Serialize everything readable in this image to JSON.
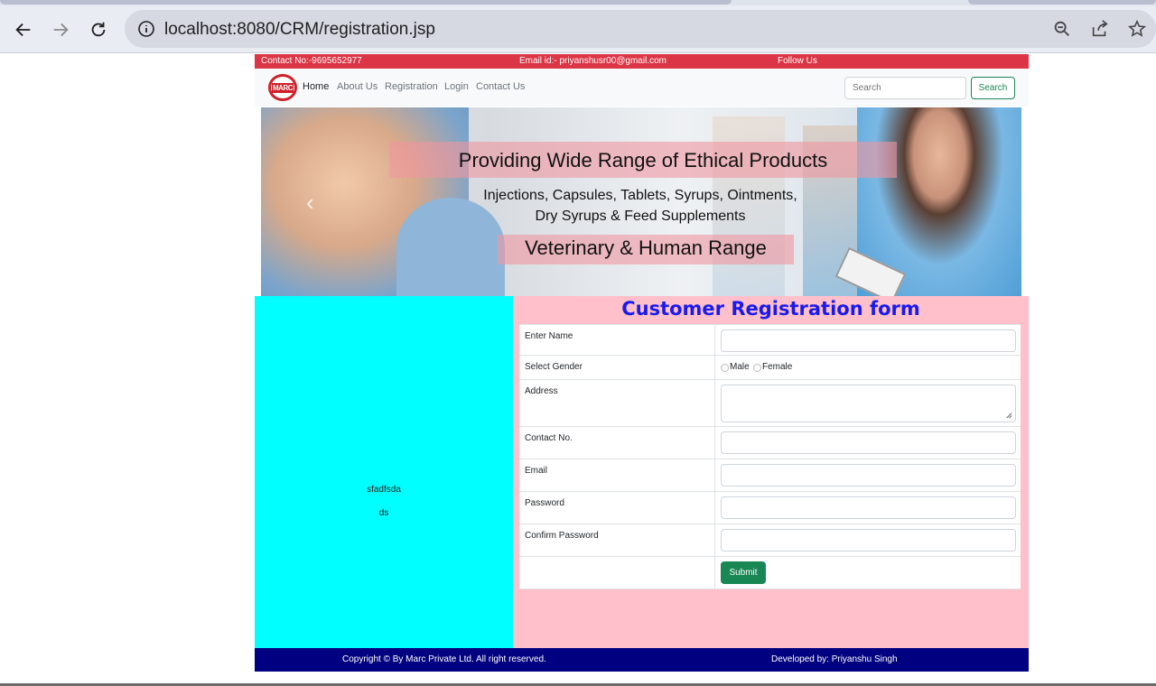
{
  "browser": {
    "url": "localhost:8080/CRM/registration.jsp"
  },
  "topbar": {
    "contact": "Contact No:-9695652977",
    "email": "Email id:- priyanshusr00@gmail.com",
    "follow": "Follow Us"
  },
  "navbar": {
    "logo_text": "MARC",
    "links": [
      "Home",
      "About Us",
      "Registration",
      "Login",
      "Contact Us"
    ],
    "search_placeholder": "Search",
    "search_button": "Search"
  },
  "banner": {
    "title": "Providing Wide Range of Ethical Products",
    "line1": "Injections, Capsules, Tablets, Syrups, Ointments,",
    "line2": "Dry Syrups & Feed Supplements",
    "line3": "Veterinary & Human Range"
  },
  "left_panel": {
    "line1": "sfadfsda",
    "line2": "ds"
  },
  "form": {
    "title": "Customer Registration form",
    "name_label": "Enter Name",
    "gender_label": "Select Gender",
    "gender_options": [
      "Male",
      "Female"
    ],
    "address_label": "Address",
    "contact_label": "Contact No.",
    "email_label": "Email",
    "password_label": "Password",
    "confirm_label": "Confirm Password",
    "submit": "Submit"
  },
  "footer": {
    "copyright": "Copyright © By Marc Private Ltd. All right reserved.",
    "developer": "Developed by: Priyanshu Singh"
  },
  "colors": {
    "topbar": "#dc3545",
    "left_panel": "#00ffff",
    "right_panel": "#ffc0cb",
    "footer": "#000080",
    "form_title": "#1a1aee",
    "submit": "#198754"
  }
}
